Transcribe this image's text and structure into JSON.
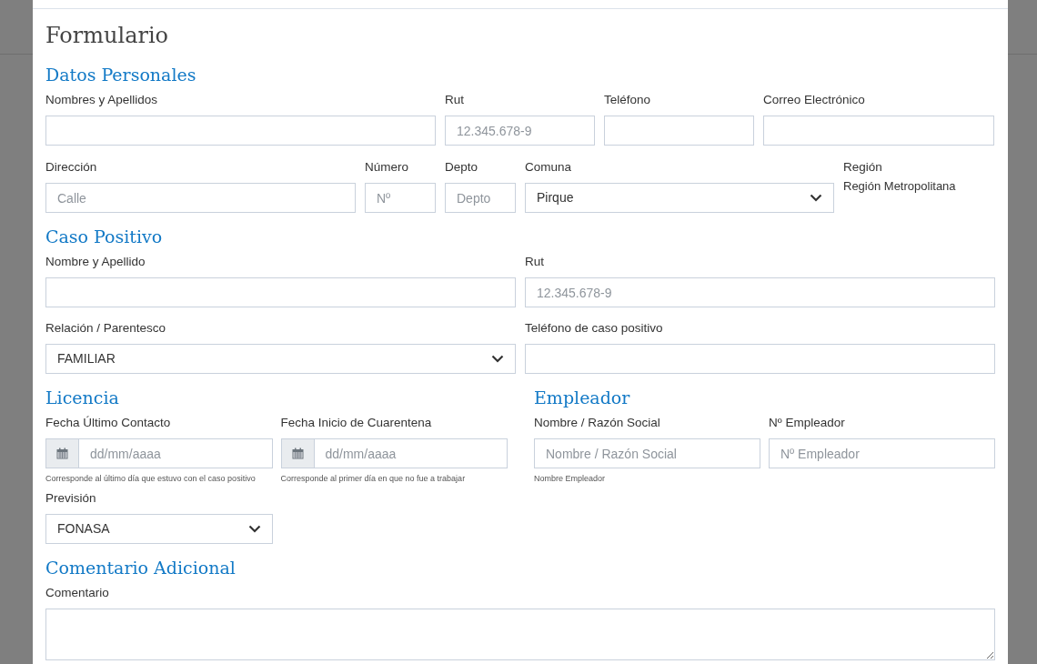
{
  "title": "Formulario",
  "datos_personales": {
    "heading": "Datos Personales",
    "fields": [
      {
        "kind": "text",
        "label": "Nombres y Apellidos"
      },
      {
        "kind": "text",
        "label": "Rut",
        "placeholder": "12.345.678-9"
      },
      {
        "kind": "text",
        "label": "Teléfono"
      },
      {
        "kind": "text",
        "label": "Correo Electrónico"
      },
      {
        "kind": "text",
        "label": "Dirección",
        "placeholder": "Calle"
      },
      {
        "kind": "text",
        "label": "Número",
        "placeholder": "Nº"
      },
      {
        "kind": "text",
        "label": "Depto",
        "placeholder": "Depto"
      },
      {
        "kind": "select",
        "label": "Comuna",
        "value": "Pirque"
      },
      {
        "kind": "static",
        "label": "Región",
        "value": "Región Metropolitana"
      }
    ]
  },
  "caso_positivo": {
    "heading": "Caso Positivo",
    "fields": [
      {
        "kind": "text",
        "label": "Nombre y Apellido"
      },
      {
        "kind": "text",
        "label": "Rut",
        "placeholder": "12.345.678-9"
      },
      {
        "kind": "select",
        "label": "Relación / Parentesco",
        "value": "FAMILIAR"
      },
      {
        "kind": "text",
        "label": "Teléfono de caso positivo"
      }
    ]
  },
  "licencia": {
    "heading": "Licencia",
    "fields": [
      {
        "kind": "date",
        "label": "Fecha Último Contacto",
        "placeholder": "dd/mm/aaaa",
        "hint": "Corresponde al último día que estuvo con el caso positivo"
      },
      {
        "kind": "date",
        "label": "Fecha Inicio de Cuarentena",
        "placeholder": "dd/mm/aaaa",
        "hint": "Corresponde al primer día en que no fue a trabajar"
      },
      {
        "kind": "select",
        "label": "Previsión",
        "value": "FONASA"
      }
    ]
  },
  "empleador": {
    "heading": "Empleador",
    "fields": [
      {
        "kind": "text",
        "label": "Nombre / Razón Social",
        "placeholder": "Nombre / Razón Social",
        "hint": "Nombre Empleador"
      },
      {
        "kind": "text",
        "label": "Nº Empleador",
        "placeholder": "Nº Empleador"
      }
    ]
  },
  "comentario": {
    "heading": "Comentario Adicional",
    "fields": [
      {
        "kind": "textarea",
        "label": "Comentario"
      }
    ]
  }
}
